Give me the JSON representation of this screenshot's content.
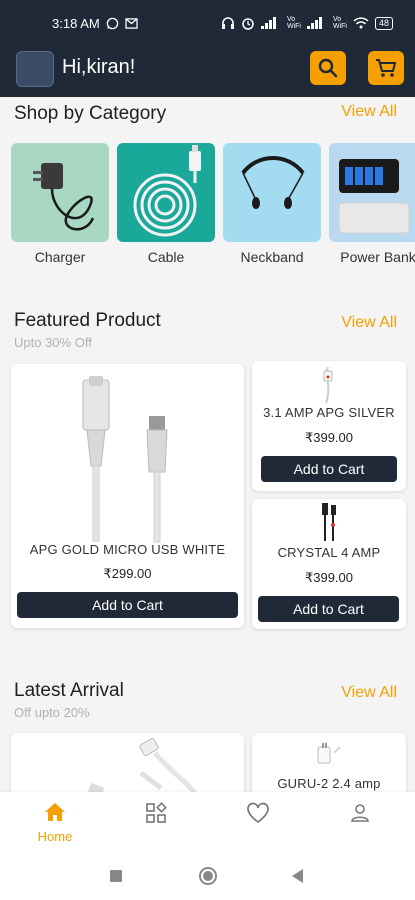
{
  "status_bar": {
    "time": "3:18 AM",
    "icons": [
      "whatsapp-icon",
      "mail-icon",
      "headphones-icon",
      "alarm-icon",
      "signal-icon",
      "vowifi-icon",
      "wifi-icon",
      "battery-icon"
    ],
    "vo_label": "Vo\nWiFi",
    "battery": "48"
  },
  "header": {
    "greeting": "Hi,kiran!",
    "accent": "#f5a000",
    "bg": "#1f2937"
  },
  "categories": {
    "title": "Shop by Category",
    "view_all": "View All",
    "items": [
      {
        "label": "Charger",
        "bg": "#a8d8c3"
      },
      {
        "label": "Cable",
        "bg": "#1aa89a"
      },
      {
        "label": "Neckband",
        "bg": "#a3dcf0"
      },
      {
        "label": "Power Bank",
        "bg": "#b9d9f0"
      }
    ]
  },
  "featured": {
    "title": "Featured Product",
    "subtitle": "Upto 30% Off",
    "view_all": "View All",
    "products": [
      {
        "name": "APG GOLD MICRO USB WHITE",
        "price": "₹299.00",
        "cta": "Add to Cart"
      },
      {
        "name": "3.1 AMP  APG SILVER",
        "price": "₹399.00",
        "cta": "Add to Cart"
      },
      {
        "name": "CRYSTAL 4 AMP",
        "price": "₹399.00",
        "cta": "Add to Cart"
      }
    ]
  },
  "latest": {
    "title": "Latest Arrival",
    "subtitle": "Off upto 20%",
    "view_all": "View All",
    "products": [
      {
        "name": "GURU-2  2.4 amp"
      }
    ]
  },
  "bottom_nav": {
    "items": [
      {
        "label": "Home",
        "icon": "home-icon",
        "active": true
      },
      {
        "label": "",
        "icon": "categories-icon",
        "active": false
      },
      {
        "label": "",
        "icon": "heart-icon",
        "active": false
      },
      {
        "label": "",
        "icon": "profile-icon",
        "active": false
      }
    ]
  }
}
